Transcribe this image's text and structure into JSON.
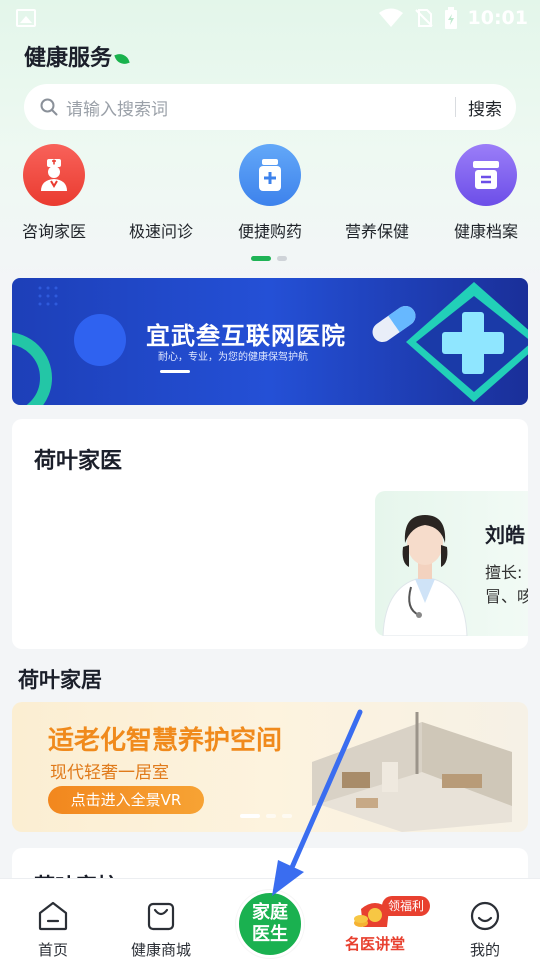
{
  "status_bar": {
    "time": "10:01"
  },
  "header": {
    "title": "健康服务"
  },
  "search": {
    "placeholder": "请输入搜索词",
    "button": "搜索"
  },
  "services": [
    {
      "label": "咨询家医",
      "icon": "doctor-icon",
      "color": "#f2473a"
    },
    {
      "label": "极速问诊",
      "icon": "",
      "color": ""
    },
    {
      "label": "便捷购药",
      "icon": "medicine-bottle-icon",
      "color": "#3d8cf0"
    },
    {
      "label": "营养保健",
      "icon": "",
      "color": ""
    },
    {
      "label": "健康档案",
      "icon": "archive-icon",
      "color": "#7b5cf0"
    }
  ],
  "banner": {
    "title": "宜武叁互联网医院",
    "subtitle": "耐心，专业，为您的健康保驾护航"
  },
  "family_doctor": {
    "title": "荷叶家医",
    "doctor": {
      "name": "刘皓",
      "skill_line1": "擅长:",
      "skill_line2": "冒、咳"
    }
  },
  "home": {
    "title": "荷叶家居",
    "banner_title": "适老化智慧养护空间",
    "banner_subtitle": "现代轻奢一居室",
    "banner_button": "点击进入全景VR"
  },
  "section3": {
    "title": "荷叶家护"
  },
  "tab_bar": {
    "home": "首页",
    "mall": "健康商城",
    "center_line1": "家庭",
    "center_line2": "医生",
    "lecture": "名医讲堂",
    "lecture_badge": "领福利",
    "me": "我的",
    "accent": "#1ab150",
    "lecture_color": "#e8402f"
  }
}
